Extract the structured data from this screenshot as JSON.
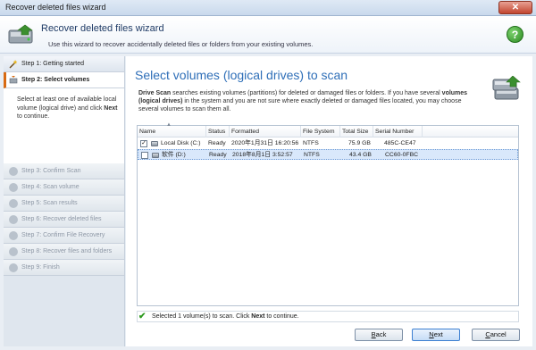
{
  "window": {
    "title": "Recover deleted files wizard"
  },
  "header": {
    "title": "Recover deleted files wizard",
    "subtitle": "Use this wizard to recover accidentally deleted files or folders from your existing volumes."
  },
  "steps": [
    {
      "label": "Step 1: Getting started",
      "state": "done",
      "icon": "wand-icon"
    },
    {
      "label": "Step 2: Select volumes",
      "state": "active",
      "icon": "volume-icon"
    },
    {
      "label": "Step 3: Confirm Scan",
      "state": "disabled",
      "icon": "confirm-icon"
    },
    {
      "label": "Step 4: Scan volume",
      "state": "disabled",
      "icon": "scan-icon"
    },
    {
      "label": "Step 5: Scan results",
      "state": "disabled",
      "icon": "results-icon"
    },
    {
      "label": "Step 6: Recover deleted files",
      "state": "disabled",
      "icon": "recover-icon"
    },
    {
      "label": "Step 7: Confirm File Recovery",
      "state": "disabled",
      "icon": "confirm-recovery-icon"
    },
    {
      "label": "Step 8: Recover files and folders",
      "state": "disabled",
      "icon": "folders-icon"
    },
    {
      "label": "Step 9: Finish",
      "state": "disabled",
      "icon": "check-icon"
    }
  ],
  "side_hint": {
    "text_before": "Select at least one of available local volume (logical drive) and click ",
    "bold": "Next",
    "text_after": " to continue."
  },
  "main": {
    "title": "Select volumes (logical drives) to scan",
    "desc": {
      "part1": "Drive Scan",
      "part2": " searches existing volumes (partitions) for deleted or damaged files or folders. If you have several ",
      "part3": "volumes (logical drives)",
      "part4": " in the system and you are not sure where exactly deleted or damaged files located, you may choose several volumes to scan them all."
    }
  },
  "table": {
    "columns": [
      "Name",
      "Status",
      "Formatted",
      "File System",
      "Total Size",
      "Serial Number"
    ],
    "rows": [
      {
        "checked": true,
        "name": "Local Disk (C:)",
        "status": "Ready",
        "formatted": "2020年1月31日 16:20:56",
        "fs": "NTFS",
        "size": "75.9 GB",
        "serial": "485C-CE47"
      },
      {
        "checked": false,
        "name": "软件 (D:)",
        "status": "Ready",
        "formatted": "2018年8月1日 3:52:57",
        "fs": "NTFS",
        "size": "43.4 GB",
        "serial": "CC60-0FBC"
      }
    ]
  },
  "status": {
    "before": "Selected 1 volume(s) to scan. Click ",
    "bold": "Next",
    "after": " to continue."
  },
  "buttons": {
    "back": {
      "u": "B",
      "rest": "ack"
    },
    "next": {
      "u": "N",
      "rest": "ext"
    },
    "cancel": {
      "u": "C",
      "rest": "ancel"
    }
  },
  "colors": {
    "accent": "#2f6fb8",
    "active_step_bar": "#d86a12",
    "status_ok": "#2e9a1f"
  }
}
